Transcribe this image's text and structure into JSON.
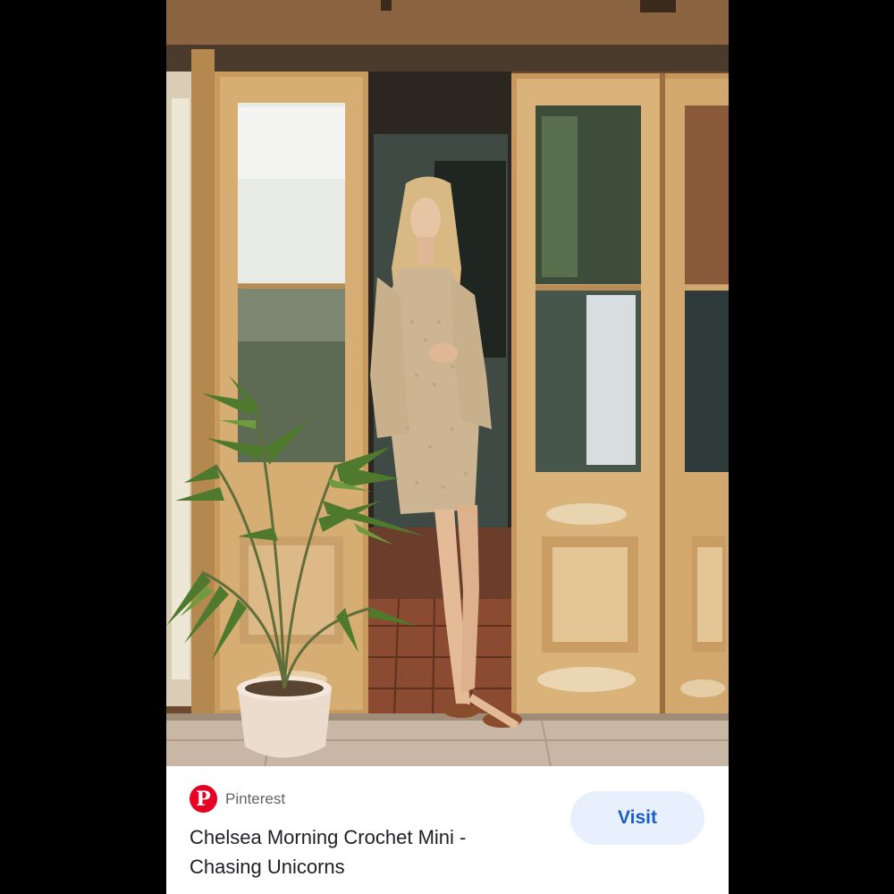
{
  "result": {
    "image_alt": "Woman in crochet mini dress standing in a wooden doorway",
    "source": {
      "name": "Pinterest",
      "logo_letter": "P",
      "logo_color": "#e60023"
    },
    "title": "Chelsea Morning Crochet Mini - Chasing Unicorns",
    "visit_label": "Visit"
  },
  "colors": {
    "visit_bg": "#e8f0fe",
    "visit_text": "#1a5dc7"
  }
}
